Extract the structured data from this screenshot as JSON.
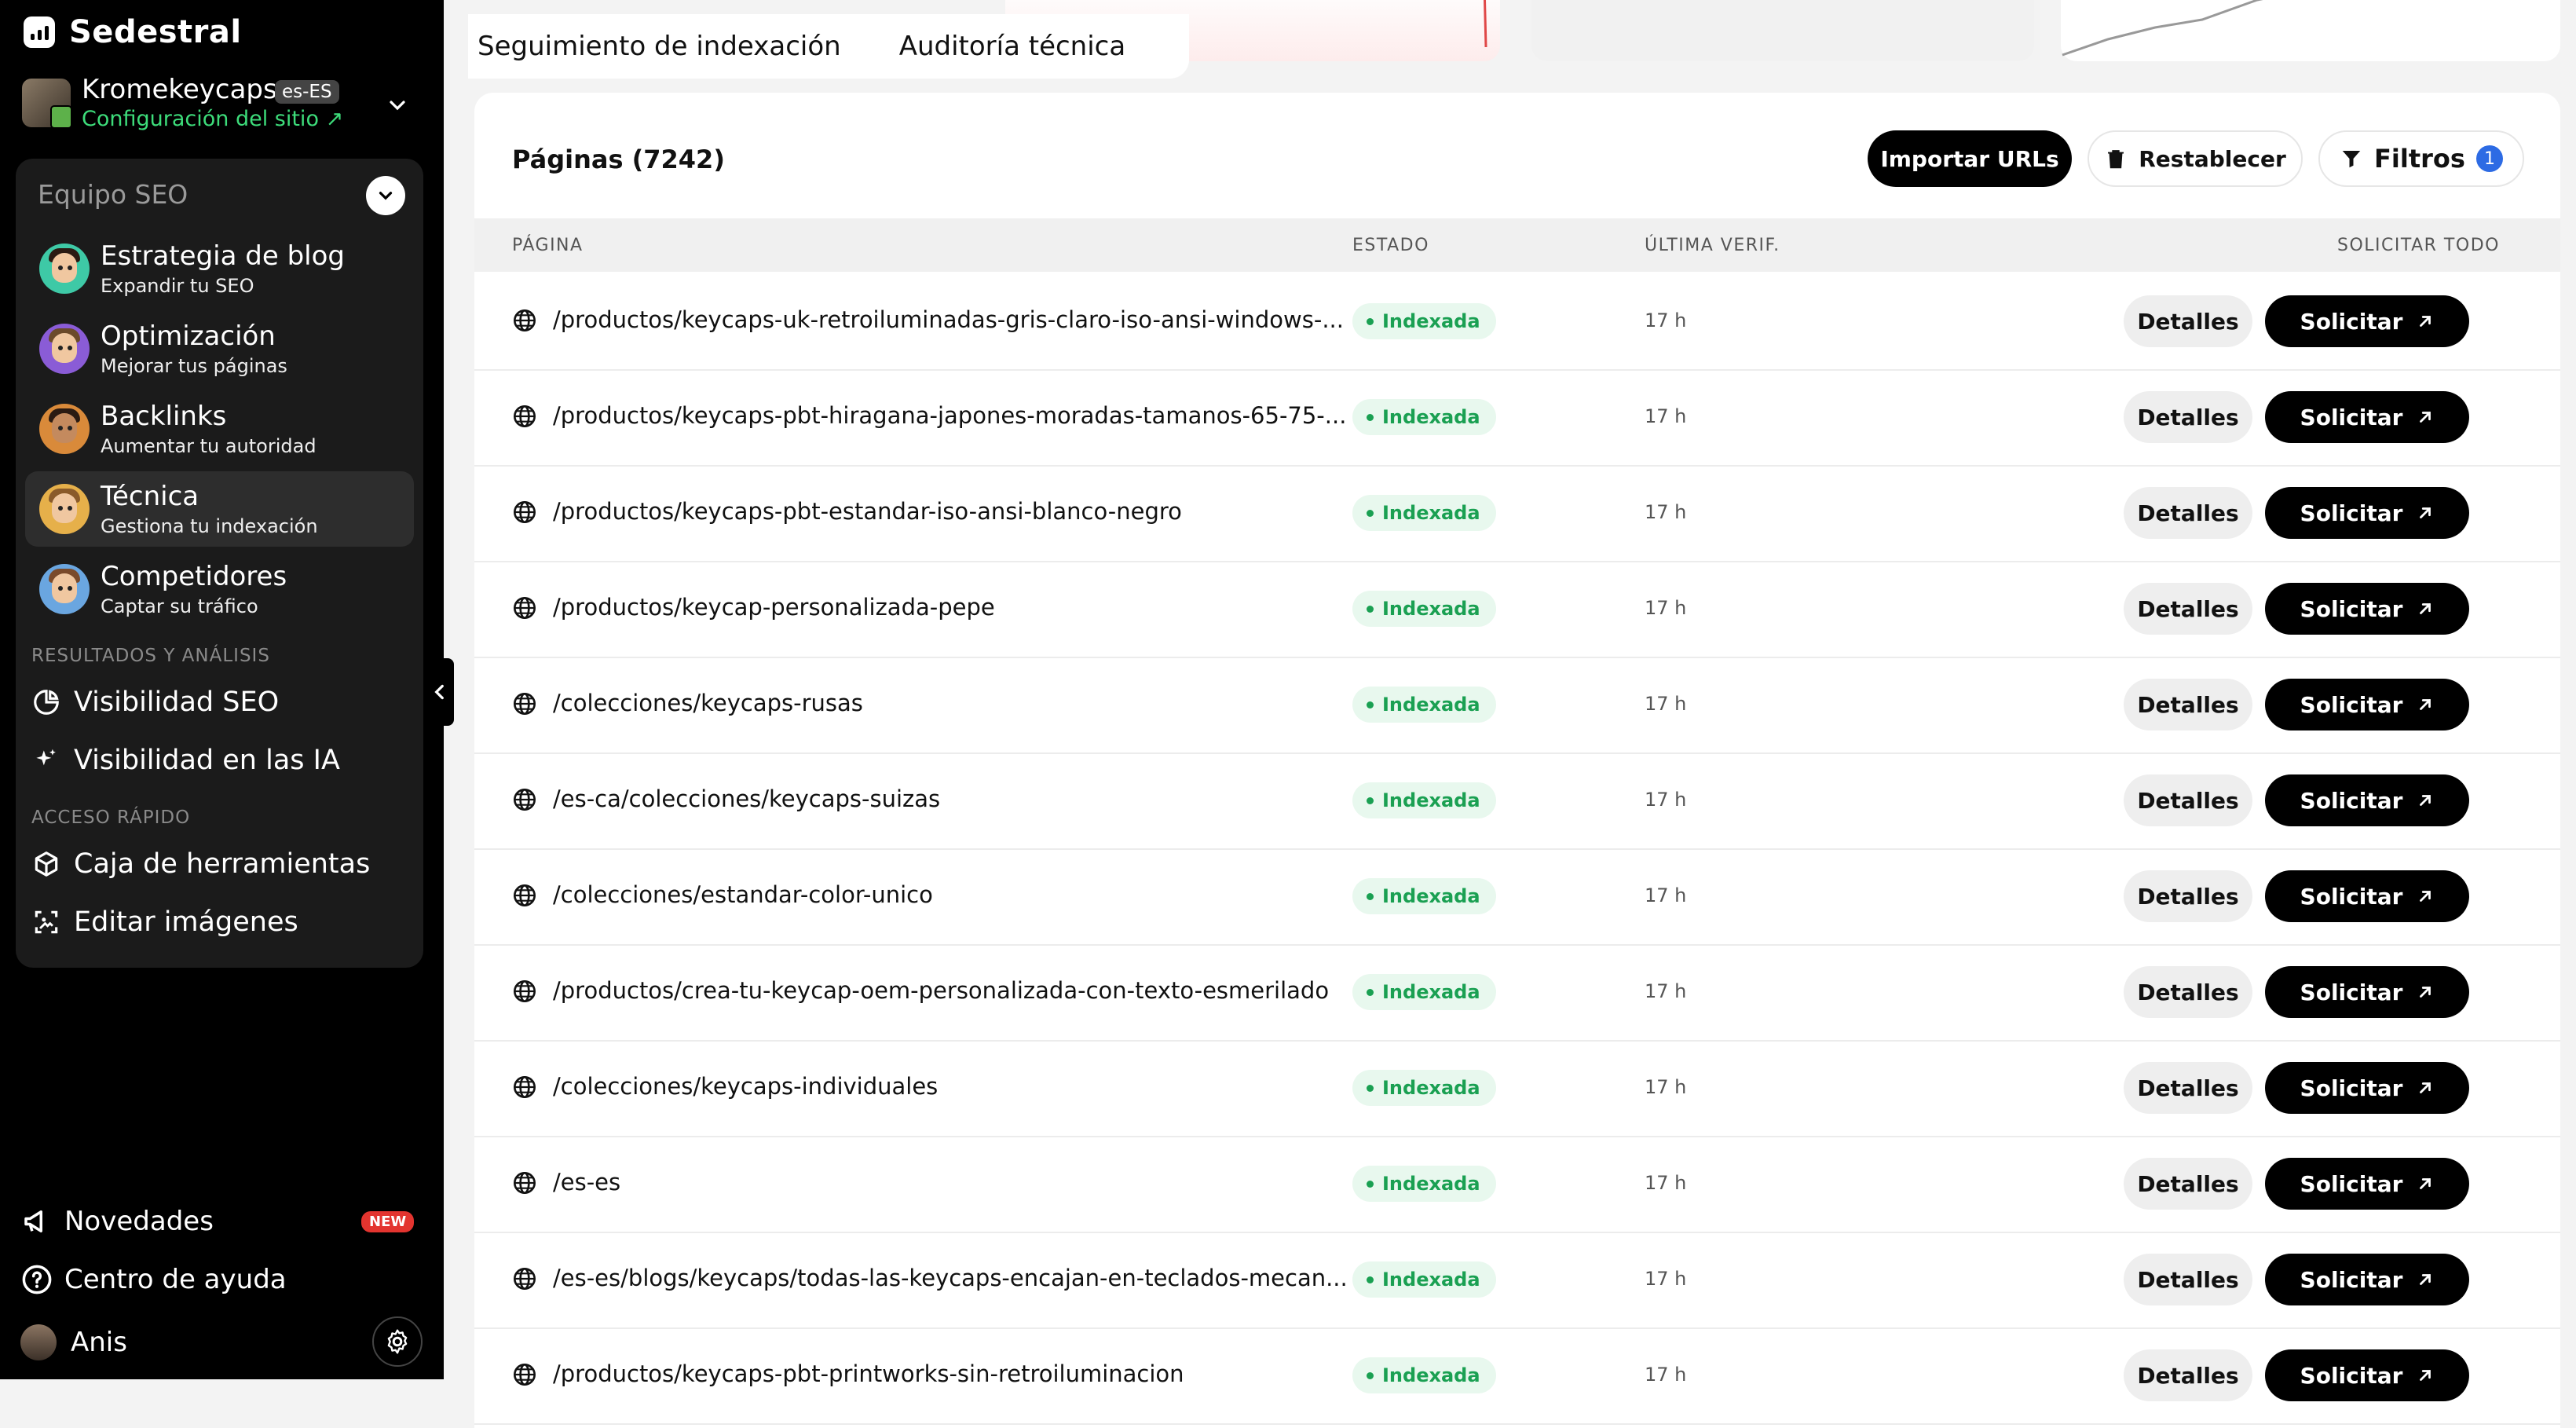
{
  "app": {
    "name": "Sedestral"
  },
  "site": {
    "name": "Kromekeycaps",
    "lang": "es-ES",
    "config_link": "Configuración del sitio"
  },
  "team": {
    "title": "Equipo SEO",
    "agents": [
      {
        "name": "Estrategia de blog",
        "sub": "Expandir tu SEO"
      },
      {
        "name": "Optimización",
        "sub": "Mejorar tus páginas"
      },
      {
        "name": "Backlinks",
        "sub": "Aumentar tu autoridad"
      },
      {
        "name": "Técnica",
        "sub": "Gestiona tu indexación"
      },
      {
        "name": "Competidores",
        "sub": "Captar su tráfico"
      }
    ]
  },
  "sections": {
    "results": "RESULTADOS Y ANÁLISIS",
    "results_items": [
      "Visibilidad SEO",
      "Visibilidad en las IA"
    ],
    "quick": "ACCESO RÁPIDO",
    "quick_items": [
      "Caja de herramientas",
      "Editar imágenes"
    ]
  },
  "bottom": {
    "news": "Novedades",
    "news_badge": "NEW",
    "help": "Centro de ayuda",
    "user": "Anis"
  },
  "tabs": [
    "Seguimiento de indexación",
    "Auditoría técnica"
  ],
  "panel": {
    "title": "Páginas (7242)",
    "import_btn": "Importar URLs",
    "reset_btn": "Restablecer",
    "filters_btn": "Filtros",
    "filters_count": "1"
  },
  "table": {
    "headers": {
      "page": "PÁGINA",
      "status": "ESTADO",
      "last": "ÚLTIMA VERIF.",
      "request_all": "SOLICITAR TODO"
    },
    "details_label": "Detalles",
    "request_label": "Solicitar",
    "rows": [
      {
        "url": "/productos/keycaps-uk-retroiluminadas-gris-claro-iso-ansi-windows-...",
        "status": "Indexada",
        "last": "17 h"
      },
      {
        "url": "/productos/keycaps-pbt-hiragana-japones-moradas-tamanos-65-75-...",
        "status": "Indexada",
        "last": "17 h"
      },
      {
        "url": "/productos/keycaps-pbt-estandar-iso-ansi-blanco-negro",
        "status": "Indexada",
        "last": "17 h"
      },
      {
        "url": "/productos/keycap-personalizada-pepe",
        "status": "Indexada",
        "last": "17 h"
      },
      {
        "url": "/colecciones/keycaps-rusas",
        "status": "Indexada",
        "last": "17 h"
      },
      {
        "url": "/es-ca/colecciones/keycaps-suizas",
        "status": "Indexada",
        "last": "17 h"
      },
      {
        "url": "/colecciones/estandar-color-unico",
        "status": "Indexada",
        "last": "17 h"
      },
      {
        "url": "/productos/crea-tu-keycap-oem-personalizada-con-texto-esmerilado",
        "status": "Indexada",
        "last": "17 h"
      },
      {
        "url": "/colecciones/keycaps-individuales",
        "status": "Indexada",
        "last": "17 h"
      },
      {
        "url": "/es-es",
        "status": "Indexada",
        "last": "17 h"
      },
      {
        "url": "/es-es/blogs/keycaps/todas-las-keycaps-encajan-en-teclados-mecan...",
        "status": "Indexada",
        "last": "17 h"
      },
      {
        "url": "/productos/keycaps-pbt-printworks-sin-retroiluminacion",
        "status": "Indexada",
        "last": "17 h"
      }
    ]
  },
  "colors": {
    "accent_green": "#3ddc7a",
    "status_green": "#1aa052",
    "badge_red": "#e3342f",
    "filter_blue": "#2d6be4"
  }
}
